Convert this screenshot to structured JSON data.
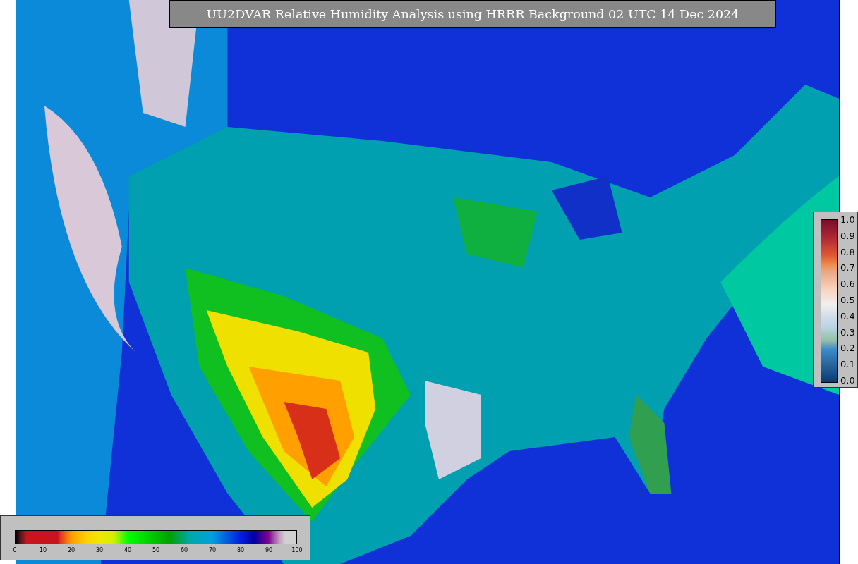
{
  "title": "UU2DVAR Relative Humidity Analysis using HRRR Background 02 UTC 14 Dec 2024",
  "humidity_colorbar": {
    "ticks": [
      "0",
      "10",
      "20",
      "30",
      "40",
      "50",
      "60",
      "70",
      "80",
      "90",
      "100"
    ]
  },
  "station_colorbar": {
    "ticks": [
      "1.0",
      "0.9",
      "0.8",
      "0.7",
      "0.6",
      "0.5",
      "0.4",
      "0.3",
      "0.2",
      "0.1",
      "0.0"
    ]
  }
}
